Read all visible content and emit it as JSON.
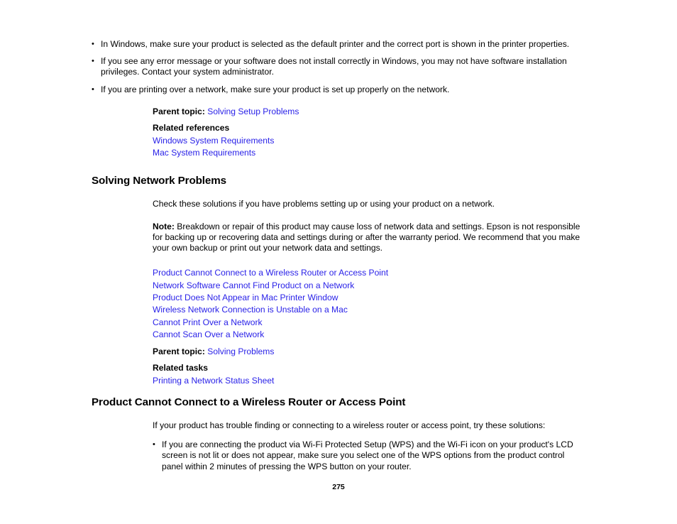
{
  "document": {
    "page_number": "275",
    "link_color": "#2a22e8",
    "text_color": "#000000",
    "background_color": "#ffffff"
  },
  "top_bullets": [
    "In Windows, make sure your product is selected as the default printer and the correct port is shown in the printer properties.",
    "If you see any error message or your software does not install correctly in Windows, you may not have software installation privileges. Contact your system administrator.",
    "If you are printing over a network, make sure your product is set up properly on the network."
  ],
  "setup_meta": {
    "parent_topic_label": "Parent topic:",
    "parent_topic_link": "Solving Setup Problems",
    "related_references_label": "Related references",
    "related_references_links": [
      "Windows System Requirements",
      "Mac System Requirements"
    ]
  },
  "network_section": {
    "heading": "Solving Network Problems",
    "intro": "Check these solutions if you have problems setting up or using your product on a network.",
    "note_label": "Note:",
    "note_text": " Breakdown or repair of this product may cause loss of network data and settings. Epson is not responsible for backing up or recovering data and settings during or after the warranty period. We recommend that you make your own backup or print out your network data and settings.",
    "topic_links": [
      "Product Cannot Connect to a Wireless Router or Access Point",
      "Network Software Cannot Find Product on a Network",
      "Product Does Not Appear in Mac Printer Window",
      "Wireless Network Connection is Unstable on a Mac",
      "Cannot Print Over a Network",
      "Cannot Scan Over a Network"
    ],
    "parent_topic_label": "Parent topic:",
    "parent_topic_link": "Solving Problems",
    "related_tasks_label": "Related tasks",
    "related_tasks_links": [
      "Printing a Network Status Sheet"
    ]
  },
  "wireless_section": {
    "heading": "Product Cannot Connect to a Wireless Router or Access Point",
    "intro": "If your product has trouble finding or connecting to a wireless router or access point, try these solutions:",
    "bullets": [
      "If you are connecting the product via Wi-Fi Protected Setup (WPS) and the Wi-Fi icon on your product's LCD screen is not lit or does not appear, make sure you select one of the WPS options from the product control panel within 2 minutes of pressing the WPS button on your router."
    ]
  }
}
